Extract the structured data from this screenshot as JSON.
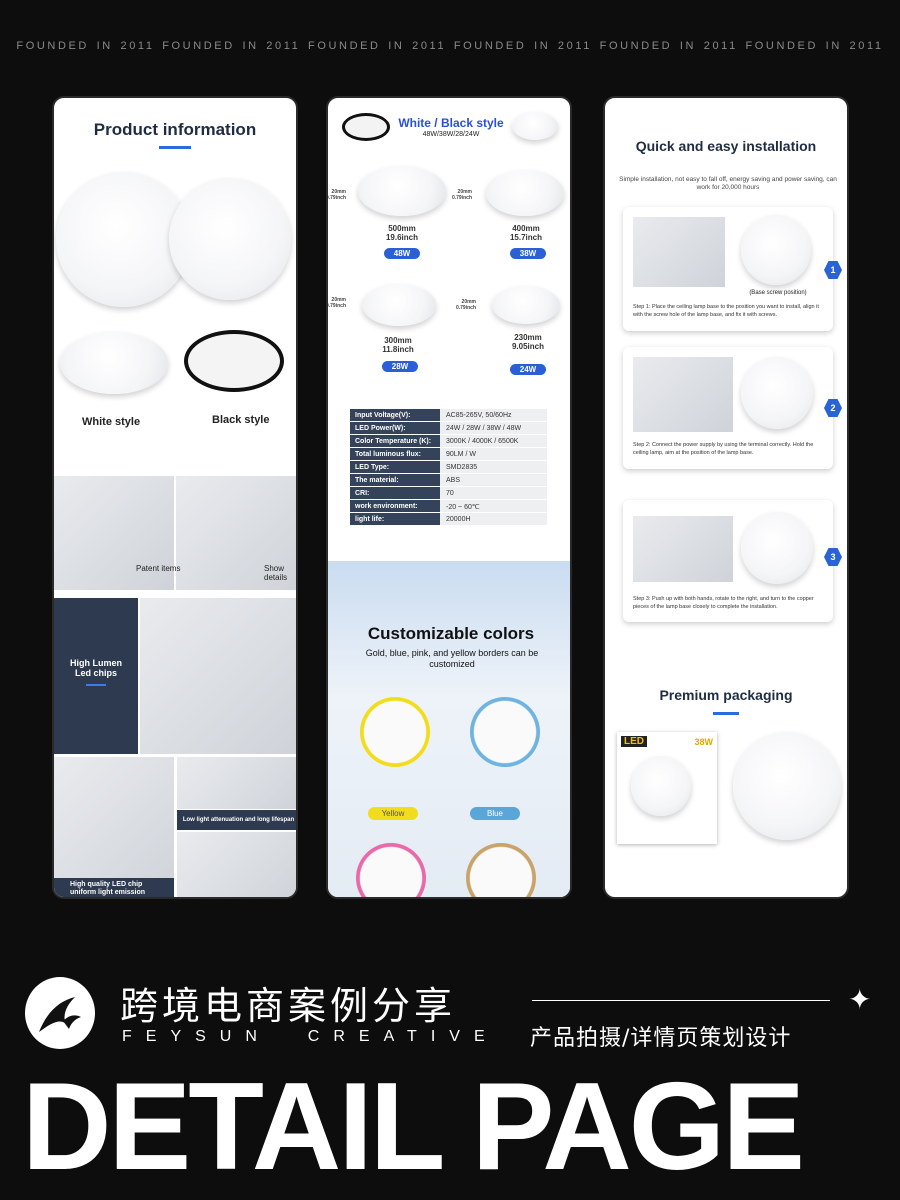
{
  "tagline": "FOUNDED IN 2011 FOUNDED IN 2011  FOUNDED IN 2011  FOUNDED IN 2011  FOUNDED IN 2011  FOUNDED IN 2011",
  "panel1": {
    "title": "Product information",
    "white_style": "White style",
    "black_style": "Black style",
    "patent": "Patent items",
    "show": "Show details",
    "lumen": "High Lumen Led chips",
    "attenuation": "Low light attenuation and long lifespan",
    "chip": "High quality LED chip uniform light emission"
  },
  "panel2": {
    "title": "White / Black style",
    "watts": "48W/38W/28/24W",
    "thickness_mm": "20mm",
    "thickness_in": "0.79inch",
    "sizes": [
      {
        "mm": "500mm",
        "inch": "19.6inch",
        "w": "48W"
      },
      {
        "mm": "400mm",
        "inch": "15.7inch",
        "w": "38W"
      },
      {
        "mm": "300mm",
        "inch": "11.8inch",
        "w": "28W"
      },
      {
        "mm": "230mm",
        "inch": "9.05inch",
        "w": "24W"
      }
    ],
    "specs": [
      {
        "k": "Input Voltage(V):",
        "v": "AC85-265V, 50/60Hz"
      },
      {
        "k": "LED Power(W):",
        "v": "24W / 28W / 38W / 48W"
      },
      {
        "k": "Color Temperature (K):",
        "v": "3000K / 4000K / 6500K"
      },
      {
        "k": "Total luminous flux:",
        "v": "90LM / W"
      },
      {
        "k": "LED Type:",
        "v": "SMD2835"
      },
      {
        "k": "The material:",
        "v": "ABS"
      },
      {
        "k": "CRI:",
        "v": "70"
      },
      {
        "k": "work environment:",
        "v": "-20 ~ 60℃"
      },
      {
        "k": "light life:",
        "v": "20000H"
      }
    ],
    "custom_title": "Customizable colors",
    "custom_sub": "Gold, blue, pink, and yellow borders can be customized",
    "yellow": "Yellow",
    "blue": "Blue",
    "colors": {
      "yellow": "#f2dc1e",
      "blue": "#6fb3e0",
      "pink": "#e86aa8",
      "gold": "#c9a46a",
      "accent": "#2a5fd8"
    }
  },
  "panel3": {
    "title": "Quick and easy installation",
    "sub": "Simple installation, not easy to fall off, energy saving and power saving, can work for 20,000 hours",
    "base_screw": "(Base screw position)",
    "steps": [
      {
        "n": "1",
        "text": "Step 1: Place the ceiling lamp base to the position you want to install, align it with the screw hole of the lamp base, and fix it with screws."
      },
      {
        "n": "2",
        "text": "Step 2: Connect the power supply by using the terminal correctly. Hold the ceiling lamp, aim at the position of the lamp base."
      },
      {
        "n": "3",
        "text": "Step 3: Push up with both hands, rotate to the right, and turn to the copper pieces of the lamp base closely to complete the installation."
      }
    ],
    "packaging": "Premium packaging",
    "box_logo": "LED",
    "box_watt": "38W"
  },
  "footer": {
    "cn_title": "跨境电商案例分享",
    "brand": "FEYSUN  CREATIVE",
    "cn_sub": "产品拍摄/详情页策划设计",
    "big": "DETAIL PAGE"
  }
}
